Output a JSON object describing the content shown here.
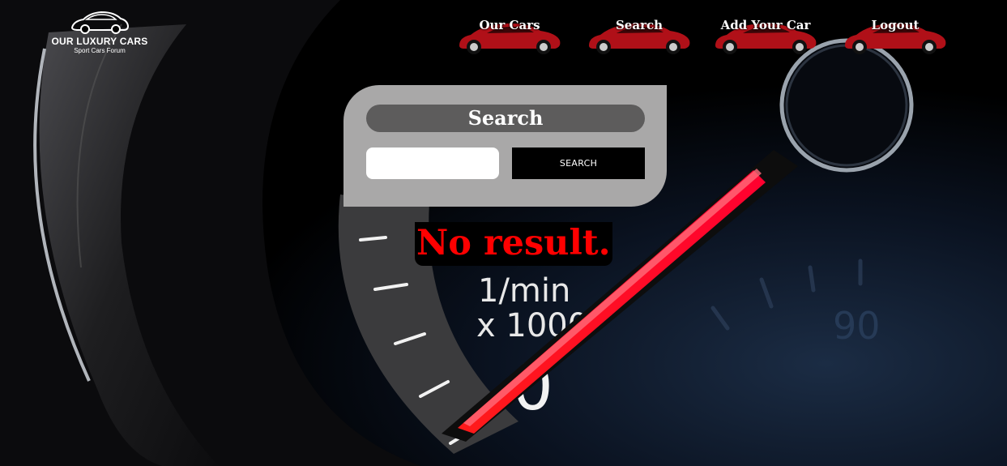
{
  "logo": {
    "title": "OUR LUXURY CARS",
    "subtitle": "Sport Cars Forum",
    "icon": "car-logo-icon"
  },
  "nav": {
    "items": [
      {
        "label": "Our Cars",
        "icon": "red-car-icon"
      },
      {
        "label": "Search",
        "icon": "red-car-icon"
      },
      {
        "label": "Add Your Car",
        "icon": "red-car-icon"
      },
      {
        "label": "Logout",
        "icon": "red-car-icon"
      }
    ]
  },
  "search": {
    "title": "Search",
    "input_value": "",
    "input_placeholder": "",
    "button_label": "SEARCH"
  },
  "result": {
    "message": "No result."
  },
  "colors": {
    "panel": "#a9a8a8",
    "title_pill": "#5d5c5c",
    "button": "#000000",
    "result_text": "#ff0000",
    "nav_car": "#b01018"
  },
  "background": {
    "icon": "speedometer-background",
    "gauge_text_1": "1/min",
    "gauge_text_2": "x 1000",
    "gauge_number": "90"
  }
}
